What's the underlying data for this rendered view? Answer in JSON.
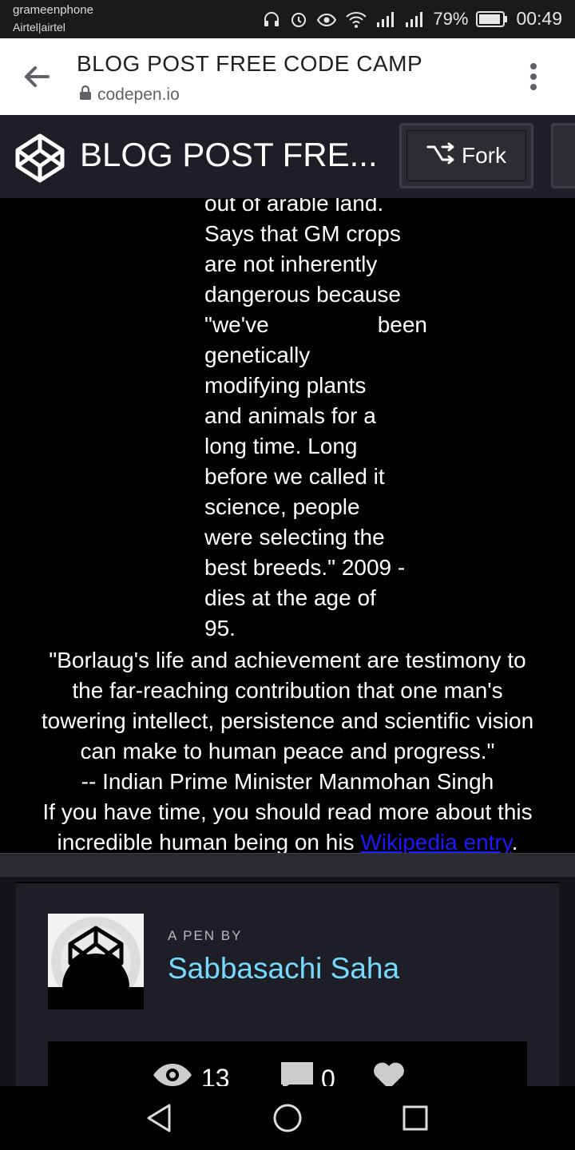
{
  "status_bar": {
    "carrier_primary": "grameenphone",
    "carrier_secondary": "Airtel|airtel",
    "battery_percent": "79%",
    "time": "00:49"
  },
  "browser": {
    "page_title": "BLOG POST FREE CODE CAMP",
    "url": "codepen.io"
  },
  "codepen_header": {
    "title": "BLOG POST FRE...",
    "fork_label": "Fork"
  },
  "content": {
    "column_lines": [
      "out of arable land.",
      "Says that GM crops",
      "are not inherently",
      "dangerous because",
      "\"we've been",
      "genetically",
      "modifying plants",
      "and animals for a",
      "long time. Long",
      "before we called it",
      "science, people",
      "were selecting the",
      "best breeds.\" 2009 -",
      "dies at the age of",
      "95."
    ],
    "quote_lines": [
      "\"Borlaug's life and achievement are testimony to",
      "the far-reaching contribution that one man's",
      "towering intellect, persistence and scientific vision",
      "can make to human peace and progress.\"",
      "-- Indian Prime Minister Manmohan Singh",
      "If you have time, you should read more about this"
    ],
    "last_line_prefix": "incredible human being on his ",
    "link_text": "Wikipedia entry",
    "last_line_suffix": "."
  },
  "footer": {
    "pen_by_label": "A PEN BY",
    "author": "Sabbasachi Saha",
    "views": "13",
    "comments": "0"
  }
}
